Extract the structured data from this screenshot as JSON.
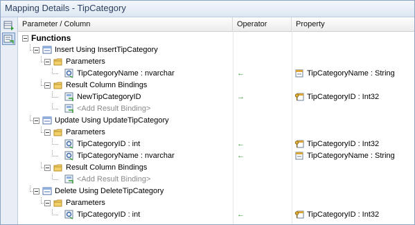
{
  "window": {
    "title": "Mapping Details - TipCategory"
  },
  "columns": {
    "param": "Parameter / Column",
    "operator": "Operator",
    "property": "Property"
  },
  "rows": [
    {
      "text": "Functions",
      "level": 0,
      "icon": "none",
      "toggle": true,
      "bold": true
    },
    {
      "text": "Insert Using InsertTipCategory",
      "level": 1,
      "icon": "function-icon",
      "toggle": true
    },
    {
      "text": "Parameters",
      "level": 2,
      "icon": "folder-icon",
      "toggle": true
    },
    {
      "text": "TipCategoryName : nvarchar",
      "level": 3,
      "icon": "parameter-icon",
      "operator": "←",
      "property": "TipCategoryName : String",
      "property_icon": "property-icon"
    },
    {
      "text": "Result Column Bindings",
      "level": 2,
      "icon": "folder-icon",
      "toggle": true
    },
    {
      "text": "NewTipCategoryID",
      "level": 3,
      "icon": "column-icon",
      "operator": "→",
      "property": "TipCategoryID : Int32",
      "property_icon": "key-property-icon"
    },
    {
      "text": "<Add Result Binding>",
      "level": 3,
      "icon": "column-icon",
      "gray": true
    },
    {
      "text": "Update Using UpdateTipCategory",
      "level": 1,
      "icon": "function-icon",
      "toggle": true
    },
    {
      "text": "Parameters",
      "level": 2,
      "icon": "folder-icon",
      "toggle": true
    },
    {
      "text": "TipCategoryID : int",
      "level": 3,
      "icon": "parameter-icon",
      "operator": "←",
      "property": "TipCategoryID : Int32",
      "property_icon": "key-property-icon"
    },
    {
      "text": "TipCategoryName : nvarchar",
      "level": 3,
      "icon": "parameter-icon",
      "operator": "←",
      "property": "TipCategoryName : String",
      "property_icon": "property-icon"
    },
    {
      "text": "Result Column Bindings",
      "level": 2,
      "icon": "folder-icon",
      "toggle": true
    },
    {
      "text": "<Add Result Binding>",
      "level": 3,
      "icon": "column-icon",
      "gray": true
    },
    {
      "text": "Delete Using DeleteTipCategory",
      "level": 1,
      "icon": "function-icon",
      "toggle": true
    },
    {
      "text": "Parameters",
      "level": 2,
      "icon": "folder-icon",
      "toggle": true
    },
    {
      "text": "TipCategoryID : int",
      "level": 3,
      "icon": "parameter-icon",
      "operator": "←",
      "property": "TipCategoryID : Int32",
      "property_icon": "key-property-icon"
    }
  ],
  "toolbar": [
    {
      "icon": "table-mapping-icon"
    },
    {
      "icon": "function-mapping-icon",
      "active": true
    }
  ],
  "colors": {
    "accent": "#2f9a2f",
    "frame": "#8aa2c4",
    "folder": "#e8c04a"
  }
}
